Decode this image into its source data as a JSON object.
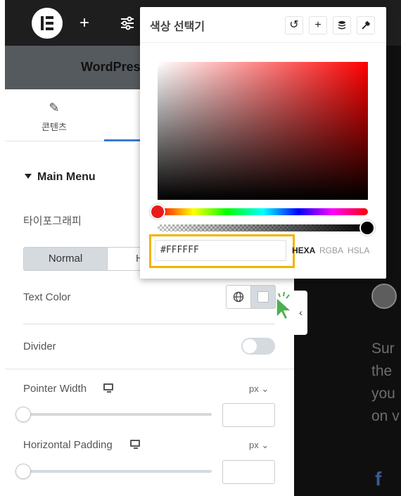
{
  "topbar": {
    "logo": "elementor-logo",
    "icons": [
      "plus-icon",
      "sliders-icon"
    ]
  },
  "panel": {
    "header_title": "WordPres",
    "tab_content_label": "콘텐츠",
    "section_title": "Main Menu",
    "typography_label": "타이포그래피",
    "state_tabs": {
      "normal": "Normal",
      "hover": "H"
    },
    "text_color_label": "Text Color",
    "divider_label": "Divider",
    "pointer_width": {
      "label": "Pointer Width",
      "unit": "px",
      "value": ""
    },
    "horizontal_padding": {
      "label": "Horizontal Padding",
      "unit": "px",
      "value": ""
    }
  },
  "color_picker": {
    "title": "색상 선택기",
    "hex_value": "#FFFFFF",
    "modes": [
      "HEXA",
      "RGBA",
      "HSLA"
    ],
    "active_mode": "HEXA",
    "buttons": [
      "reset-icon",
      "add-icon",
      "stack-icon",
      "eyedropper-icon"
    ],
    "hue_color": "#ff0000"
  },
  "preview": {
    "text": "Sur\nthe\nyou\non v"
  }
}
